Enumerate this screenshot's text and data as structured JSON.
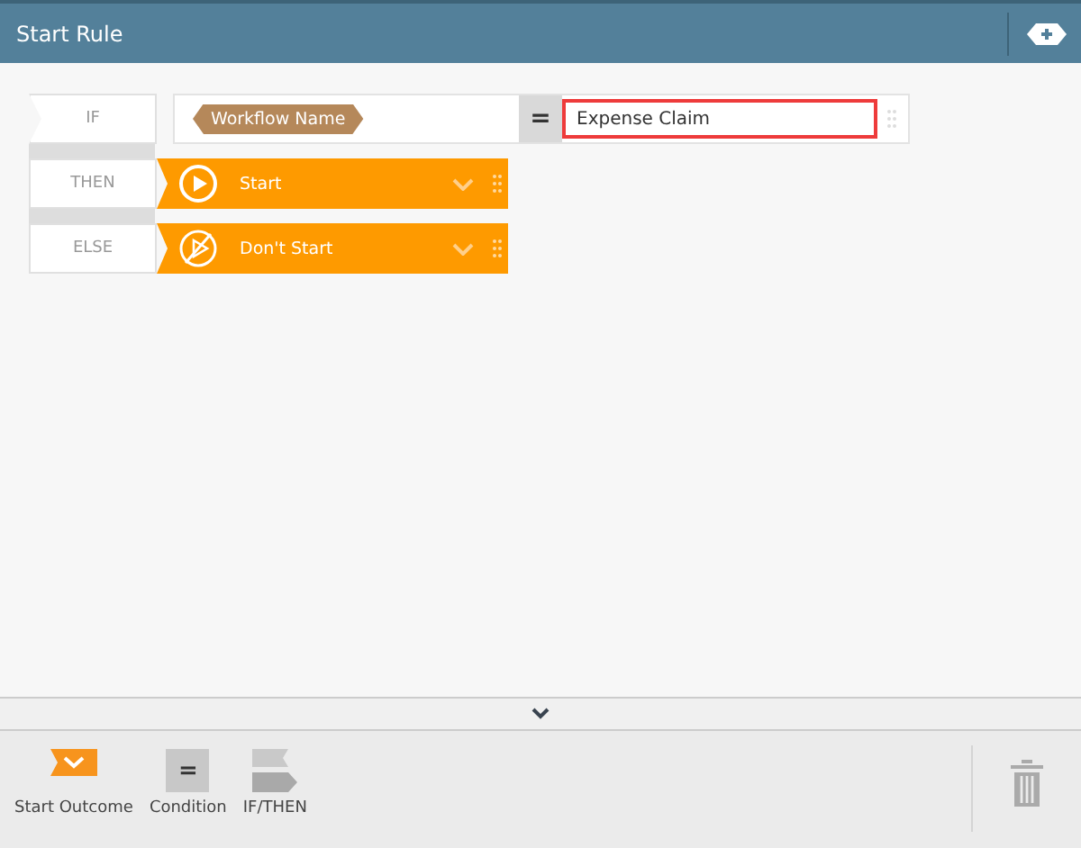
{
  "header": {
    "title": "Start Rule"
  },
  "rule": {
    "if_label": "IF",
    "field": "Workflow Name",
    "operator": "=",
    "value": "Expense Claim",
    "outcomes": [
      {
        "label": "THEN",
        "kind": "start",
        "text": "Start"
      },
      {
        "label": "ELSE",
        "kind": "dont",
        "text": "Don't Start"
      }
    ]
  },
  "toolbar": {
    "items": [
      {
        "kind": "outcome",
        "label": "Start Outcome"
      },
      {
        "kind": "condition",
        "label": "Condition",
        "symbol": "="
      },
      {
        "kind": "ifthen",
        "label": "IF/THEN"
      }
    ]
  }
}
